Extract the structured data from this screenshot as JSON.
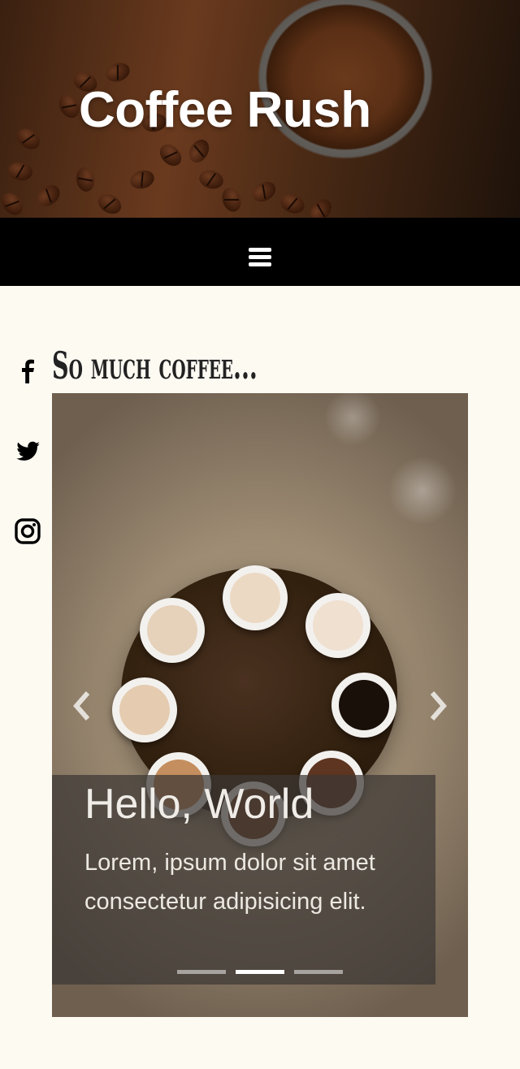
{
  "header": {
    "title": "Coffee Rush"
  },
  "nav": {
    "menu_icon": "hamburger-menu-icon"
  },
  "social": [
    {
      "name": "facebook",
      "icon": "facebook-icon"
    },
    {
      "name": "twitter",
      "icon": "twitter-icon"
    },
    {
      "name": "instagram",
      "icon": "instagram-icon"
    }
  ],
  "section": {
    "title": "So much coffee..."
  },
  "carousel": {
    "caption_title": "Hello, World",
    "caption_text": "Lorem, ipsum dolor sit amet consectetur adipisicing elit.",
    "prev_icon": "chevron-left-icon",
    "next_icon": "chevron-right-icon",
    "slide_count": 3,
    "active_index": 1
  },
  "colors": {
    "page_background": "#fdfaf2",
    "navbar": "#000000",
    "text_dark": "#222222"
  }
}
